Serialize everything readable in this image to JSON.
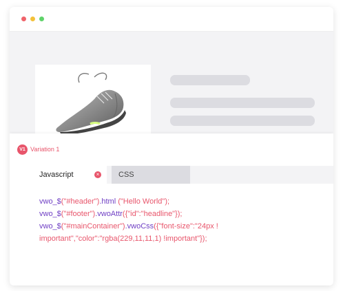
{
  "colors": {
    "window_dot_red": "#f0636a",
    "window_dot_yellow": "#f3c13a",
    "window_dot_green": "#5fd36a",
    "accent": "#e8556b",
    "code_keyword": "#6f3fc4",
    "code_string": "#e8556b",
    "code_text": "#222222"
  },
  "product": {
    "image_icon": "sneaker-icon"
  },
  "variation": {
    "badge": "V1",
    "label": "Variation 1"
  },
  "tabs": {
    "javascript": "Javascript",
    "close_icon": "close-icon",
    "css": "CSS"
  },
  "code": {
    "line1": {
      "fn": "vwo_$",
      "arg": "(\"#header\")",
      "method": ".html",
      "value": " (\"Hello World\");"
    },
    "line2": {
      "fn": "vwo_$",
      "arg": "(\"#footer\")",
      "method": ".vwoAttr",
      "value": "({\"id\":\"headline\"});"
    },
    "line3": {
      "fn": "vwo_$",
      "arg": "(\"#mainContainer\")",
      "method": ".vwoCss",
      "value": "({\"font-size\":\"24px !"
    },
    "line4": {
      "value": "important\",\"color\":\"rgba(229,11,11,1) !important\"});"
    }
  }
}
